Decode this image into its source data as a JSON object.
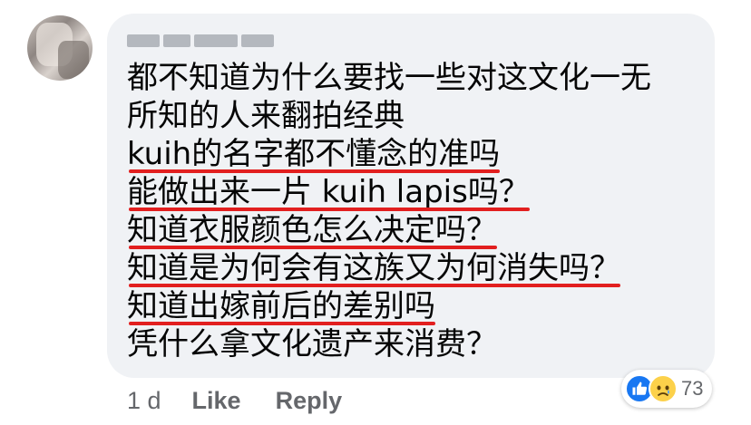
{
  "comment": {
    "lines": [
      "都不知道为什么要找一些对这文化一无",
      "所知的人来翻拍经典",
      "kuih的名字都不懂念的准吗",
      "能做出来一片 kuih lapis吗？",
      "知道衣服颜色怎么决定吗？",
      "知道是为何会有这族又为何消失吗？",
      "知道出嫁前后的差别吗",
      "凭什么拿文化遗产来消费？"
    ]
  },
  "actions": {
    "time": "1 d",
    "like": "Like",
    "reply": "Reply"
  },
  "reactions": {
    "icons": [
      "thumbs-up-icon",
      "sad-face-icon"
    ],
    "count": "73",
    "colors": {
      "like": "#1877f2",
      "sad": "#fcd14a"
    }
  },
  "colors": {
    "bubble": "#f0f2f5",
    "text": "#050505",
    "muted": "#65676b",
    "underline": "#e21f1f"
  }
}
